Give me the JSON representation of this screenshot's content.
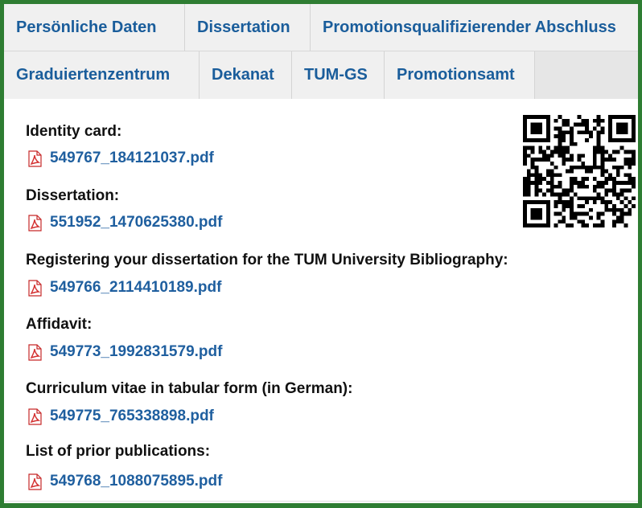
{
  "tabs_row1": [
    {
      "label": "Persönliche Daten"
    },
    {
      "label": "Dissertation"
    },
    {
      "label": "Promotionsqualifizierender Abschluss"
    }
  ],
  "tabs_row2": [
    {
      "label": "Graduiertenzentrum"
    },
    {
      "label": "Dekanat"
    },
    {
      "label": "TUM-GS"
    },
    {
      "label": "Promotionsamt"
    }
  ],
  "documents": [
    {
      "label": "Identity card:",
      "file": "549767_184121037.pdf"
    },
    {
      "label": "Dissertation:",
      "file": "551952_1470625380.pdf"
    },
    {
      "label": "Registering your dissertation for the TUM University Bibliography:",
      "file": "549766_2114410189.pdf"
    },
    {
      "label": "Affidavit:",
      "file": "549773_1992831579.pdf"
    },
    {
      "label": "Curriculum vitae in tabular form (in German):",
      "file": "549775_765338898.pdf"
    },
    {
      "label": "List of prior publications:",
      "file": "549768_1088075895.pdf"
    }
  ],
  "icons": {
    "file": "pdf-file-icon",
    "qr": "qr-code"
  },
  "colors": {
    "border": "#2e7d32",
    "link": "#1f5f9f",
    "tab_text": "#1a5d9b",
    "pdf_icon": "#d32f2f"
  }
}
